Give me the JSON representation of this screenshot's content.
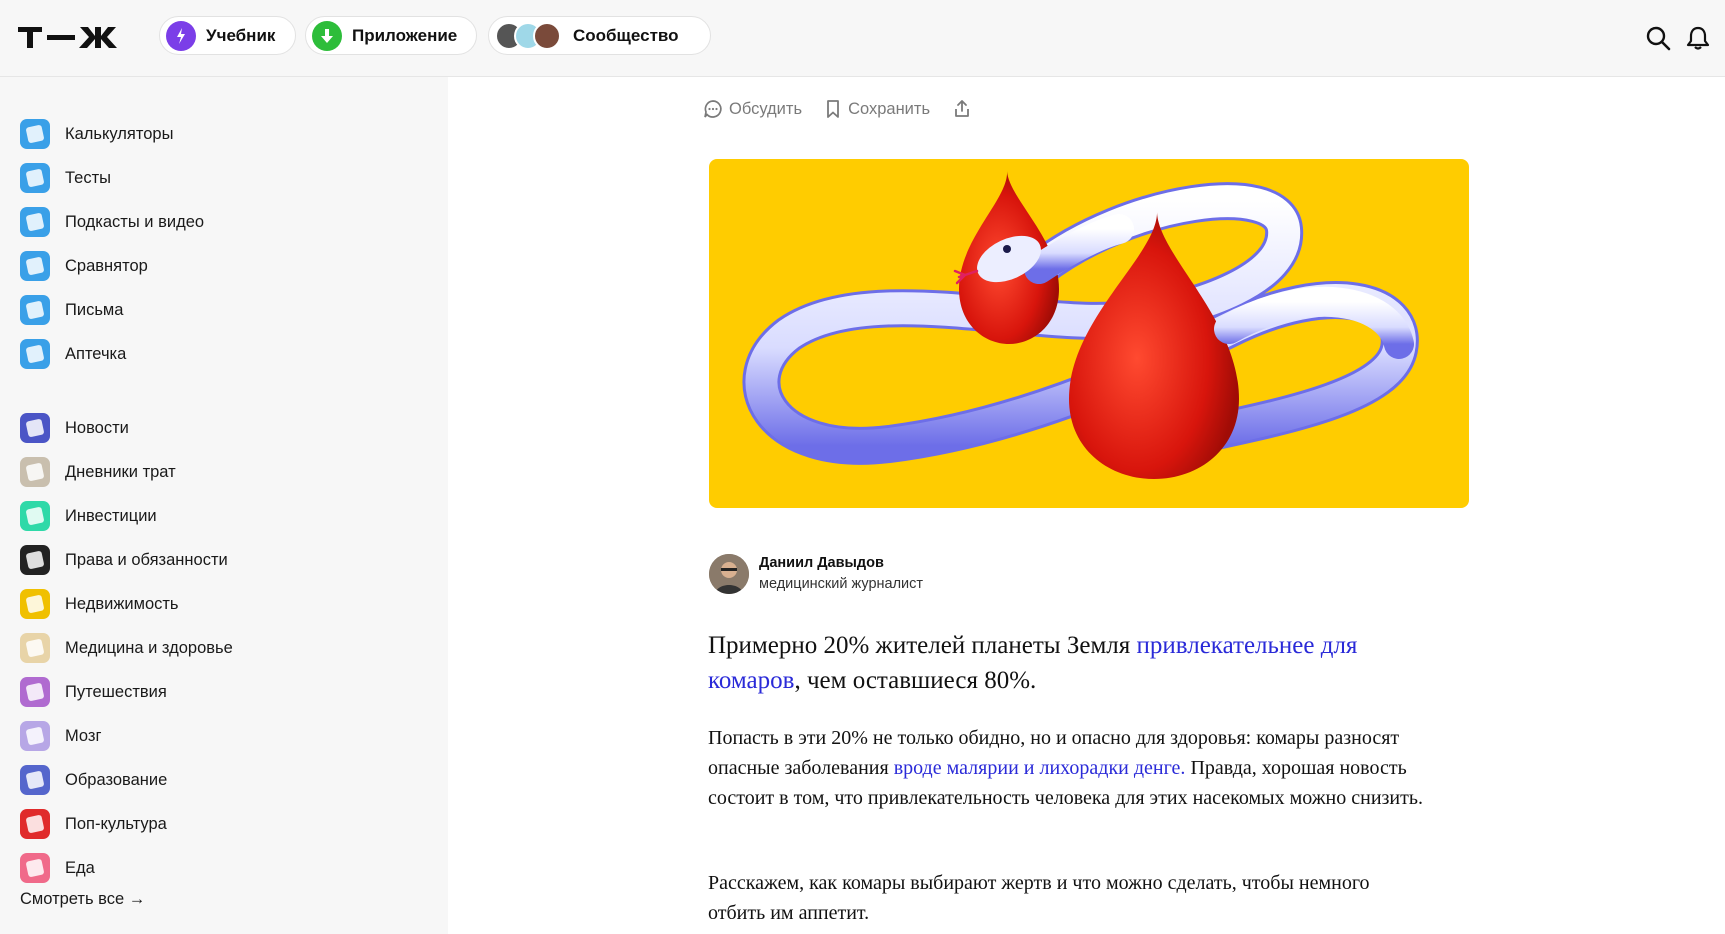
{
  "header": {
    "logo_text": "Т—Ж",
    "pills": {
      "textbook": "Учебник",
      "app": "Приложение",
      "community": "Сообщество"
    },
    "icons": [
      "search-icon",
      "bell-icon"
    ]
  },
  "sidebar": {
    "items": [
      {
        "label": "Калькуляторы",
        "icon": "calculator-icon",
        "color": "#3aa0e8"
      },
      {
        "label": "Тесты",
        "icon": "gamepad-icon",
        "color": "#3aa0e8"
      },
      {
        "label": "Подкасты и видео",
        "icon": "play-icon",
        "color": "#3aa0e8"
      },
      {
        "label": "Сравнятор",
        "icon": "compare-icon",
        "color": "#3aa0e8"
      },
      {
        "label": "Письма",
        "icon": "letter-icon",
        "color": "#3aa0e8"
      },
      {
        "label": "Аптечка",
        "icon": "first-aid-icon",
        "color": "#3aa0e8"
      },
      {
        "label": "Новости",
        "icon": "news-icon",
        "color": "#4b55c6"
      },
      {
        "label": "Дневники трат",
        "icon": "diary-icon",
        "color": "#c9bfae"
      },
      {
        "label": "Инвестиции",
        "icon": "investment-icon",
        "color": "#2fd9a8"
      },
      {
        "label": "Права и обязанности",
        "icon": "gavel-icon",
        "color": "#222222"
      },
      {
        "label": "Недвижимость",
        "icon": "house-icon",
        "color": "#f0c000"
      },
      {
        "label": "Медицина и здоровье",
        "icon": "bandage-icon",
        "color": "#e8d4a8"
      },
      {
        "label": "Путешествия",
        "icon": "suitcase-icon",
        "color": "#b06bd0"
      },
      {
        "label": "Мозг",
        "icon": "brain-icon",
        "color": "#b7a7e6"
      },
      {
        "label": "Образование",
        "icon": "pencil-icon",
        "color": "#5566cc"
      },
      {
        "label": "Поп-культура",
        "icon": "hand-icon",
        "color": "#e02b2b"
      },
      {
        "label": "Еда",
        "icon": "food-icon",
        "color": "#f06a8a"
      }
    ],
    "see_all": "Смотреть все →"
  },
  "toolbar": {
    "discuss": "Обсудить",
    "save": "Сохранить"
  },
  "author": {
    "name": "Даниил Давыдов",
    "role": "медицинский журналист"
  },
  "article": {
    "lead_before": "Примерно 20% жителей планеты Земля ",
    "lead_link": "привлекательнее для комаров",
    "lead_after": ", чем оставшиеся 80%.",
    "p1_before": "Попасть в эти 20% не только обидно, но и опасно для здоровья: комары разносят опасные заболевания ",
    "p1_link": "вроде малярии и лихорадки денге.",
    "p1_after": " Правда, хорошая новость состоит в том, что привлекательность человека для этих насекомых можно снизить.",
    "p2": "Расскажем, как комары выбирают жертв и что можно сделать, чтобы немного отбить им аппетит."
  },
  "colors": {
    "accent_link": "#2a2ad8",
    "hero_bg": "#ffcc00",
    "blood": "#e01a10"
  }
}
